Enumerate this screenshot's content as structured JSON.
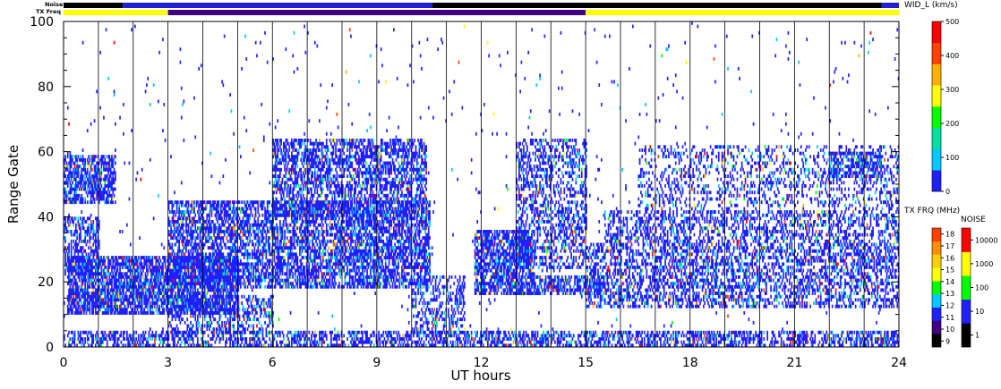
{
  "chart_data": {
    "type": "heatmap",
    "xlabel": "UT hours",
    "ylabel": "Range Gate",
    "x_ticks": [
      0,
      3,
      6,
      9,
      12,
      15,
      18,
      21,
      24
    ],
    "y_ticks": [
      0,
      20,
      40,
      60,
      80,
      100
    ],
    "xlim": [
      0,
      24
    ],
    "ylim": [
      0,
      100
    ],
    "hour_grid": true,
    "top_bars": [
      {
        "name": "Noise",
        "color_segments": [
          {
            "x0": 0,
            "x1": 1.7,
            "color": "#000000"
          },
          {
            "x0": 1.7,
            "x1": 10.6,
            "color": "#2020d0"
          },
          {
            "x0": 10.6,
            "x1": 23.5,
            "color": "#000000"
          },
          {
            "x0": 23.5,
            "x1": 24,
            "color": "#2020d0"
          }
        ]
      },
      {
        "name": "TX Freq",
        "color_segments": [
          {
            "x0": 0,
            "x1": 3,
            "color": "#ffff00"
          },
          {
            "x0": 3,
            "x1": 15,
            "color": "#400080"
          },
          {
            "x0": 15,
            "x1": 24,
            "color": "#ffff00"
          }
        ]
      }
    ],
    "colorbars": [
      {
        "title": "WID_L (km/s)",
        "ticks": [
          0,
          100,
          200,
          300,
          400,
          500
        ],
        "colors": [
          "#2020ff",
          "#00c8ff",
          "#00e0a0",
          "#00ff00",
          "#ffff00",
          "#ffb000",
          "#ff4000",
          "#ff0000"
        ]
      },
      {
        "title": "TX FRQ (MHz)",
        "ticks": [
          9,
          10,
          11,
          12,
          13,
          14,
          15,
          16,
          17,
          18
        ],
        "colors": [
          "#000000",
          "#400080",
          "#2020ff",
          "#00c8ff",
          "#00ff00",
          "#ffff00",
          "#ffd000",
          "#ff9000",
          "#ff4000"
        ]
      },
      {
        "title": "NOISE",
        "ticks": [
          1,
          10,
          100,
          1000,
          10000
        ],
        "colors": [
          "#000000",
          "#2020ff",
          "#00ff00",
          "#ffff00",
          "#ff0000"
        ]
      }
    ],
    "scatter_regions": [
      {
        "x0": 0.0,
        "x1": 1.5,
        "y0": 44,
        "y1": 59,
        "density": 0.65
      },
      {
        "x0": 0.1,
        "x1": 5.0,
        "y0": 10,
        "y1": 28,
        "density": 0.72
      },
      {
        "x0": 0.0,
        "x1": 1.0,
        "y0": 22,
        "y1": 40,
        "density": 0.45
      },
      {
        "x0": 3.0,
        "x1": 10.5,
        "y0": 18,
        "y1": 45,
        "density": 0.6
      },
      {
        "x0": 6.0,
        "x1": 10.4,
        "y0": 40,
        "y1": 64,
        "density": 0.55
      },
      {
        "x0": 0.0,
        "x1": 24.0,
        "y0": 0,
        "y1": 5,
        "density": 0.5
      },
      {
        "x0": 3.0,
        "x1": 6.0,
        "y0": 4,
        "y1": 16,
        "density": 0.4
      },
      {
        "x0": 10.0,
        "x1": 11.5,
        "y0": 4,
        "y1": 22,
        "density": 0.35
      },
      {
        "x0": 11.8,
        "x1": 13.5,
        "y0": 16,
        "y1": 36,
        "density": 0.7
      },
      {
        "x0": 13.0,
        "x1": 15.0,
        "y0": 24,
        "y1": 64,
        "density": 0.4
      },
      {
        "x0": 13.5,
        "x1": 15.5,
        "y0": 16,
        "y1": 22,
        "density": 0.55
      },
      {
        "x0": 15.0,
        "x1": 24.0,
        "y0": 12,
        "y1": 32,
        "density": 0.45
      },
      {
        "x0": 15.5,
        "x1": 24.0,
        "y0": 32,
        "y1": 42,
        "density": 0.4
      },
      {
        "x0": 16.5,
        "x1": 24.0,
        "y0": 42,
        "y1": 62,
        "density": 0.25
      },
      {
        "x0": 22.0,
        "x1": 23.5,
        "y0": 52,
        "y1": 60,
        "density": 0.55
      },
      {
        "x0": 0.0,
        "x1": 24.0,
        "y0": 5,
        "y1": 100,
        "density": 0.01
      }
    ]
  }
}
